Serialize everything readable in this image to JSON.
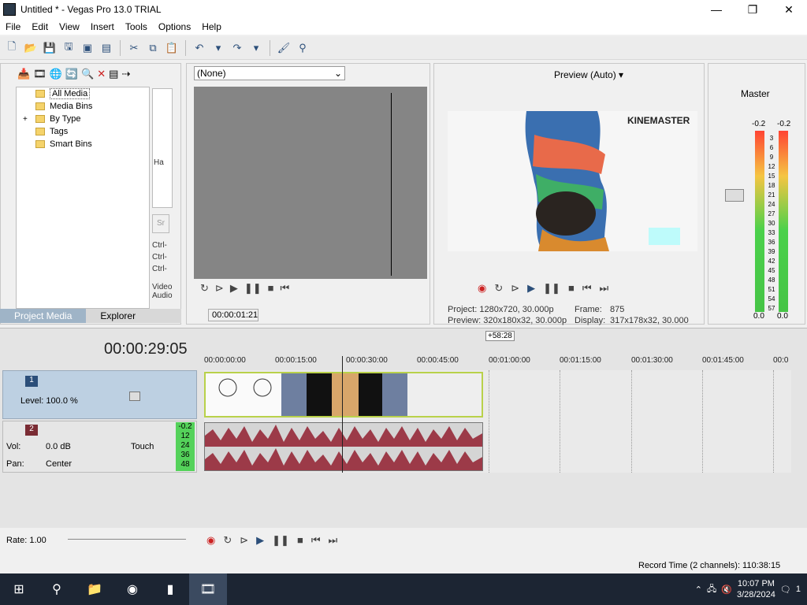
{
  "window": {
    "title": "Untitled * - Vegas Pro 13.0 TRIAL",
    "minimize": "—",
    "maximize": "❐",
    "close": "✕"
  },
  "menu": [
    "File",
    "Edit",
    "View",
    "Insert",
    "Tools",
    "Options",
    "Help"
  ],
  "project_media": {
    "tree": [
      "All Media",
      "Media Bins",
      "By Type",
      "Tags",
      "Smart Bins"
    ],
    "expander": "+",
    "tabs": [
      "Project Media",
      "Explorer"
    ],
    "side_labels": [
      "Ha",
      "Sr",
      "Ctrl-",
      "Ctrl-",
      "Ctrl-",
      "Video",
      "Audio"
    ]
  },
  "trimmer": {
    "select_value": "(None)",
    "timecode": "00:00:01:21"
  },
  "preview": {
    "mode": "Preview (Auto)",
    "watermark": "KINEMASTER",
    "project_label": "Project:",
    "project_value": "1280x720, 30.000p",
    "preview_label": "Preview:",
    "preview_value": "320x180x32, 30.000p",
    "frame_label": "Frame:",
    "frame_value": "875",
    "display_label": "Display:",
    "display_value": "317x178x32, 30.000"
  },
  "master": {
    "label": "Master",
    "peak_left": "-0.2",
    "peak_right": "-0.2",
    "scale": [
      "3",
      "6",
      "9",
      "12",
      "15",
      "18",
      "21",
      "24",
      "27",
      "30",
      "33",
      "36",
      "39",
      "42",
      "45",
      "48",
      "51",
      "54",
      "57"
    ],
    "floor_left": "0.0",
    "floor_right": "0.0"
  },
  "timeline": {
    "position": "00:00:29:05",
    "offset_badge": "+58:28",
    "ruler": [
      "00:00:00:00",
      "00:00:15:00",
      "00:00:30:00",
      "00:00:45:00",
      "00:01:00:00",
      "00:01:15:00",
      "00:01:30:00",
      "00:01:45:00",
      "00:0"
    ],
    "video_track": {
      "number": "1",
      "level_label": "Level: 100.0 %"
    },
    "audio_track": {
      "number": "2",
      "vol_label": "Vol:",
      "vol_value": "0.0 dB",
      "pan_label": "Pan:",
      "pan_value": "Center",
      "automation": "Touch",
      "meter_peak": "-0.2",
      "meter_scale": [
        "12",
        "24",
        "36",
        "48"
      ]
    },
    "rate": "Rate: 1.00"
  },
  "status": {
    "record_time": "Record Time (2 channels): 110:38:15"
  },
  "taskbar": {
    "time": "10:07 PM",
    "date": "3/28/2024",
    "notifications": "1"
  }
}
